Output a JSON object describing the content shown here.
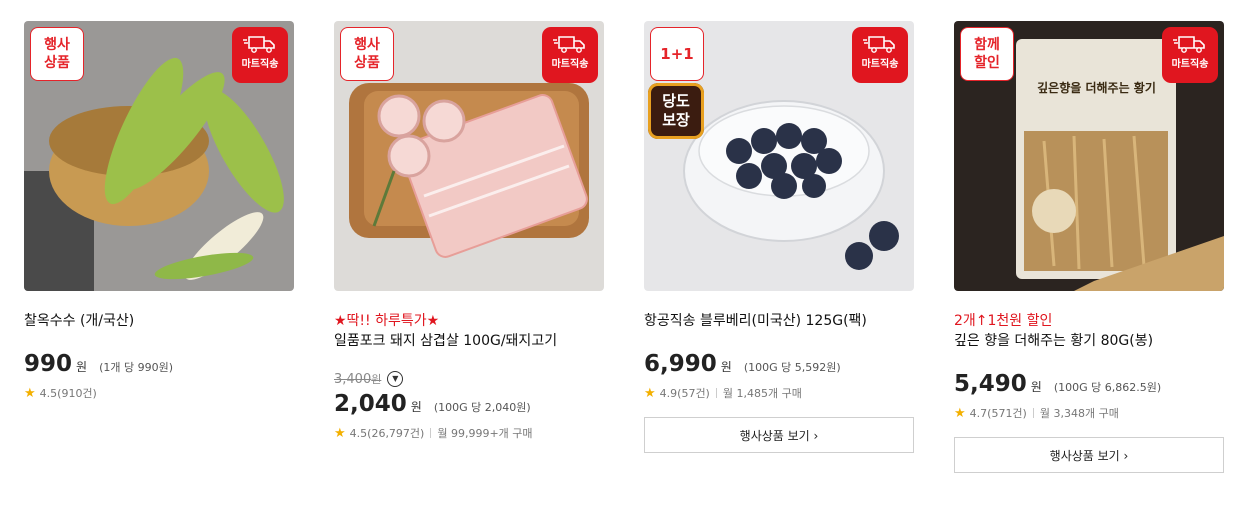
{
  "products": [
    {
      "tag": "행사\n상품",
      "mart_label": "마트직송",
      "promo": "",
      "name": "찰옥수수 (개/국산)",
      "original_price": "",
      "price": "990",
      "currency": "원",
      "unit_price": "(1개 당 990원)",
      "rating": "4.5(910건)",
      "monthly": "",
      "button": ""
    },
    {
      "tag": "행사\n상품",
      "mart_label": "마트직송",
      "promo": "★딱!! 하루특가★",
      "name": "일품포크 돼지 삼겹살 100G/돼지고기",
      "original_price": "3,400",
      "original_currency": "원",
      "price": "2,040",
      "currency": "원",
      "unit_price": "(100G 당 2,040원)",
      "rating": "4.5(26,797건)",
      "monthly": "월 99,999+개 구매",
      "button": ""
    },
    {
      "tag": "1+1",
      "mart_label": "마트직송",
      "sugar_badge": "당도\n보장",
      "promo": "",
      "name": "항공직송 블루베리(미국산) 125G(팩)",
      "original_price": "",
      "price": "6,990",
      "currency": "원",
      "unit_price": "(100G 당 5,592원)",
      "rating": "4.9(57건)",
      "monthly": "월 1,485개 구매",
      "button": "행사상품 보기 ›"
    },
    {
      "tag": "함께\n할인",
      "mart_label": "마트직송",
      "promo": "2개↑1천원 할인",
      "name": "깊은 향을 더해주는 황기 80G(봉)",
      "package_text": "깊은향을 더해주는 황기",
      "original_price": "",
      "price": "5,490",
      "currency": "원",
      "unit_price": "(100G 당 6,862.5원)",
      "rating": "4.7(571건)",
      "monthly": "월 3,348개 구매",
      "button": "행사상품 보기 ›"
    }
  ],
  "colors": {
    "accent": "#e0161f",
    "star": "#f3b000"
  },
  "icons": {
    "delivery": "delivery-truck-icon",
    "rating": "star-icon",
    "expand": "chevron-down-icon"
  }
}
